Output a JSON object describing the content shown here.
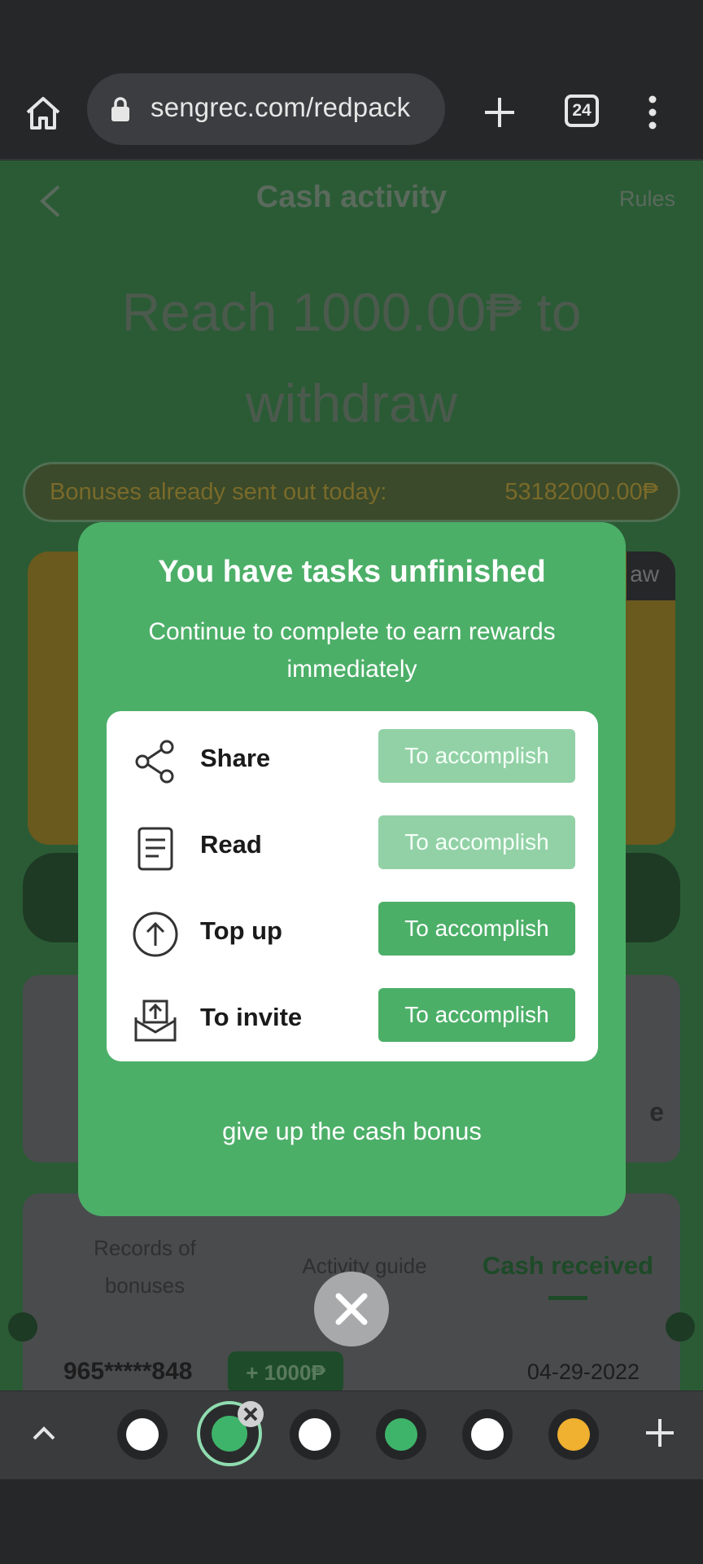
{
  "browser": {
    "url": "sengrec.com/redpack",
    "tab_count": "24"
  },
  "page": {
    "title": "Cash activity",
    "rules_label": "Rules",
    "headline": "Reach 1000.00₱ to withdraw",
    "bonus_label": "Bonuses already sent out today:",
    "bonus_value": "53182000.00₱",
    "card_fragment": "aw",
    "card2_fragment": "e",
    "tabs": {
      "records": "Records of bonuses",
      "guide": "Activity guide",
      "cash": "Cash received"
    },
    "record": {
      "user": "965*****848",
      "amount": "+ 1000₱",
      "date": "04-29-2022"
    }
  },
  "modal": {
    "title": "You have tasks unfinished",
    "subtitle": "Continue to complete to earn rewards immediately",
    "tasks": [
      {
        "name": "Share",
        "icon": "share-icon",
        "button": "To accomplish",
        "state": "faded"
      },
      {
        "name": "Read",
        "icon": "document-icon",
        "button": "To accomplish",
        "state": "faded"
      },
      {
        "name": "Top up",
        "icon": "arrow-up-circle-icon",
        "button": "To accomplish",
        "state": "active"
      },
      {
        "name": "To invite",
        "icon": "inbox-upload-icon",
        "button": "To accomplish",
        "state": "active"
      }
    ],
    "give_up": "give up the cash bonus"
  },
  "colors": {
    "modal_green": "#4caf68",
    "button_faded": "#92d1a6",
    "accent_dark_green": "#1d4a27"
  }
}
